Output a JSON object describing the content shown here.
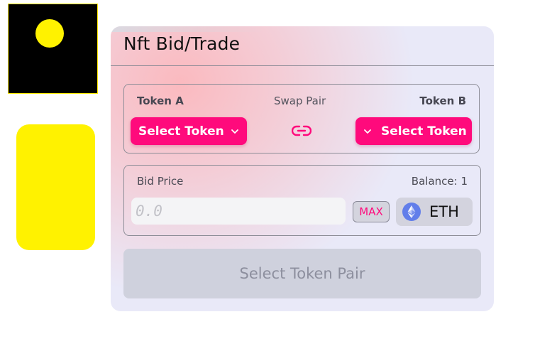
{
  "card": {
    "title": "Nft Bid/Trade"
  },
  "swap": {
    "token_a_label": "Token A",
    "pair_label": "Swap Pair",
    "token_b_label": "Token B",
    "select_token_a": "Select Token",
    "select_token_b": "Select Token",
    "link_icon": "link-icon",
    "chevron_icon": "chevron-down-icon"
  },
  "bid": {
    "label": "Bid Price",
    "balance": "Balance: 1",
    "placeholder": "0.0",
    "value": "",
    "max_label": "MAX",
    "currency": "ETH",
    "currency_icon": "ethereum-icon"
  },
  "action": {
    "label": "Select Token Pair"
  },
  "colors": {
    "accent": "#ff0a7c",
    "decoration_yellow": "#fff200",
    "card_bg": "#e9e9f8",
    "disabled_button": "#cfd1dd"
  }
}
